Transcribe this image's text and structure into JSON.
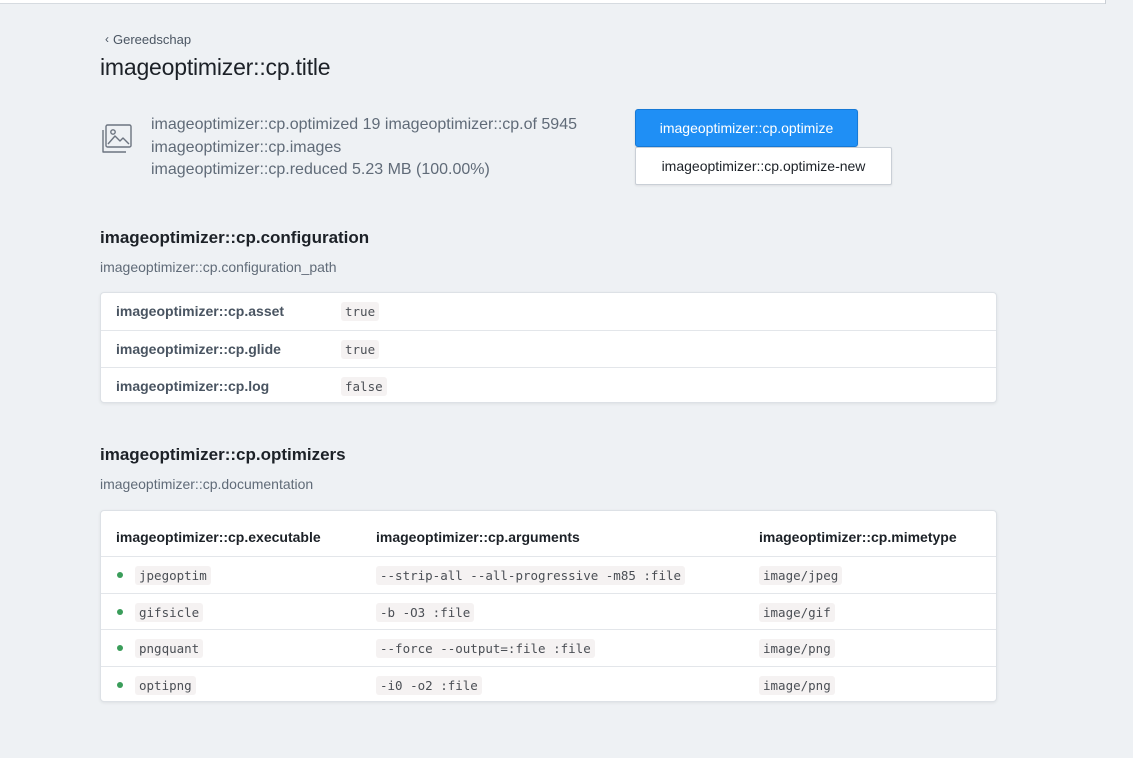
{
  "breadcrumb": {
    "label": "Gereedschap"
  },
  "page_title": "imageoptimizer::cp.title",
  "stats": {
    "line1": "imageoptimizer::cp.optimized 19 imageoptimizer::cp.of 5945",
    "line2": "imageoptimizer::cp.images",
    "line3": "imageoptimizer::cp.reduced 5.23 MB (100.00%)",
    "icon": "images-icon"
  },
  "actions": {
    "optimize_label": "imageoptimizer::cp.optimize",
    "optimize_new_label": "imageoptimizer::cp.optimize-new"
  },
  "configuration": {
    "title": "imageoptimizer::cp.configuration",
    "subtitle": "imageoptimizer::cp.configuration_path",
    "rows": [
      {
        "key": "imageoptimizer::cp.asset",
        "value": "true"
      },
      {
        "key": "imageoptimizer::cp.glide",
        "value": "true"
      },
      {
        "key": "imageoptimizer::cp.log",
        "value": "false"
      }
    ]
  },
  "optimizers": {
    "title": "imageoptimizer::cp.optimizers",
    "subtitle": "imageoptimizer::cp.documentation",
    "columns": [
      "imageoptimizer::cp.executable",
      "imageoptimizer::cp.arguments",
      "imageoptimizer::cp.mimetype"
    ],
    "rows": [
      {
        "executable": "jpegoptim",
        "arguments": "--strip-all --all-progressive -m85 :file",
        "mimetype": "image/jpeg"
      },
      {
        "executable": "gifsicle",
        "arguments": "-b -O3 :file",
        "mimetype": "image/gif"
      },
      {
        "executable": "pngquant",
        "arguments": "--force --output=:file :file",
        "mimetype": "image/png"
      },
      {
        "executable": "optipng",
        "arguments": "-i0 -o2 :file",
        "mimetype": "image/png"
      }
    ],
    "status_color": "#3a9d5a"
  },
  "colors": {
    "accent": "#1f8ff5",
    "background": "#eef1f4"
  }
}
